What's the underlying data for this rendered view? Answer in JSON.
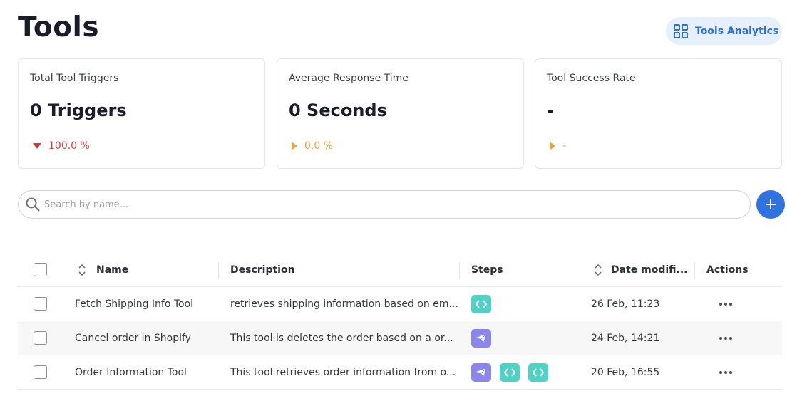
{
  "page": {
    "title": "Tools"
  },
  "analytics_button": {
    "label": "Tools Analytics",
    "icon": "grid-icon"
  },
  "cards": [
    {
      "label": "Total Tool Triggers",
      "value": "0 Triggers",
      "trend": "100.0 %",
      "trend_dir": "down",
      "trend_color": "#d23b3b"
    },
    {
      "label": "Average Response Time",
      "value": "0 Seconds",
      "trend": "0.0 %",
      "trend_dir": "flat",
      "trend_color": "#e8a33a"
    },
    {
      "label": "Tool Success Rate",
      "value": "-",
      "trend": "-",
      "trend_dir": "flat",
      "trend_color": "#e8a33a"
    }
  ],
  "search": {
    "placeholder": "Search by name...",
    "value": ""
  },
  "add_button": {
    "icon": "plus-icon",
    "color": "#2f72e0"
  },
  "table": {
    "columns": {
      "name": "Name",
      "description": "Description",
      "steps": "Steps",
      "date": "Date modifi...",
      "actions": "Actions"
    },
    "rows": [
      {
        "name": "Fetch Shipping Info Tool",
        "description": "retrieves shipping information based on em...",
        "steps": [
          "code"
        ],
        "date": "26 Feb, 11:23"
      },
      {
        "name": "Cancel order in Shopify",
        "description": "This tool is deletes the order based on a or...",
        "steps": [
          "send"
        ],
        "date": "24 Feb, 14:21"
      },
      {
        "name": "Order Information Tool",
        "description": "This tool retrieves order information from o...",
        "steps": [
          "send",
          "code",
          "code"
        ],
        "date": "20 Feb, 16:55"
      }
    ]
  },
  "colors": {
    "accent": "#2f72e0",
    "code_step": "#4fd1c5",
    "send_step": "#8a86ec",
    "trend_down": "#d23b3b",
    "trend_flat": "#e8a33a"
  }
}
